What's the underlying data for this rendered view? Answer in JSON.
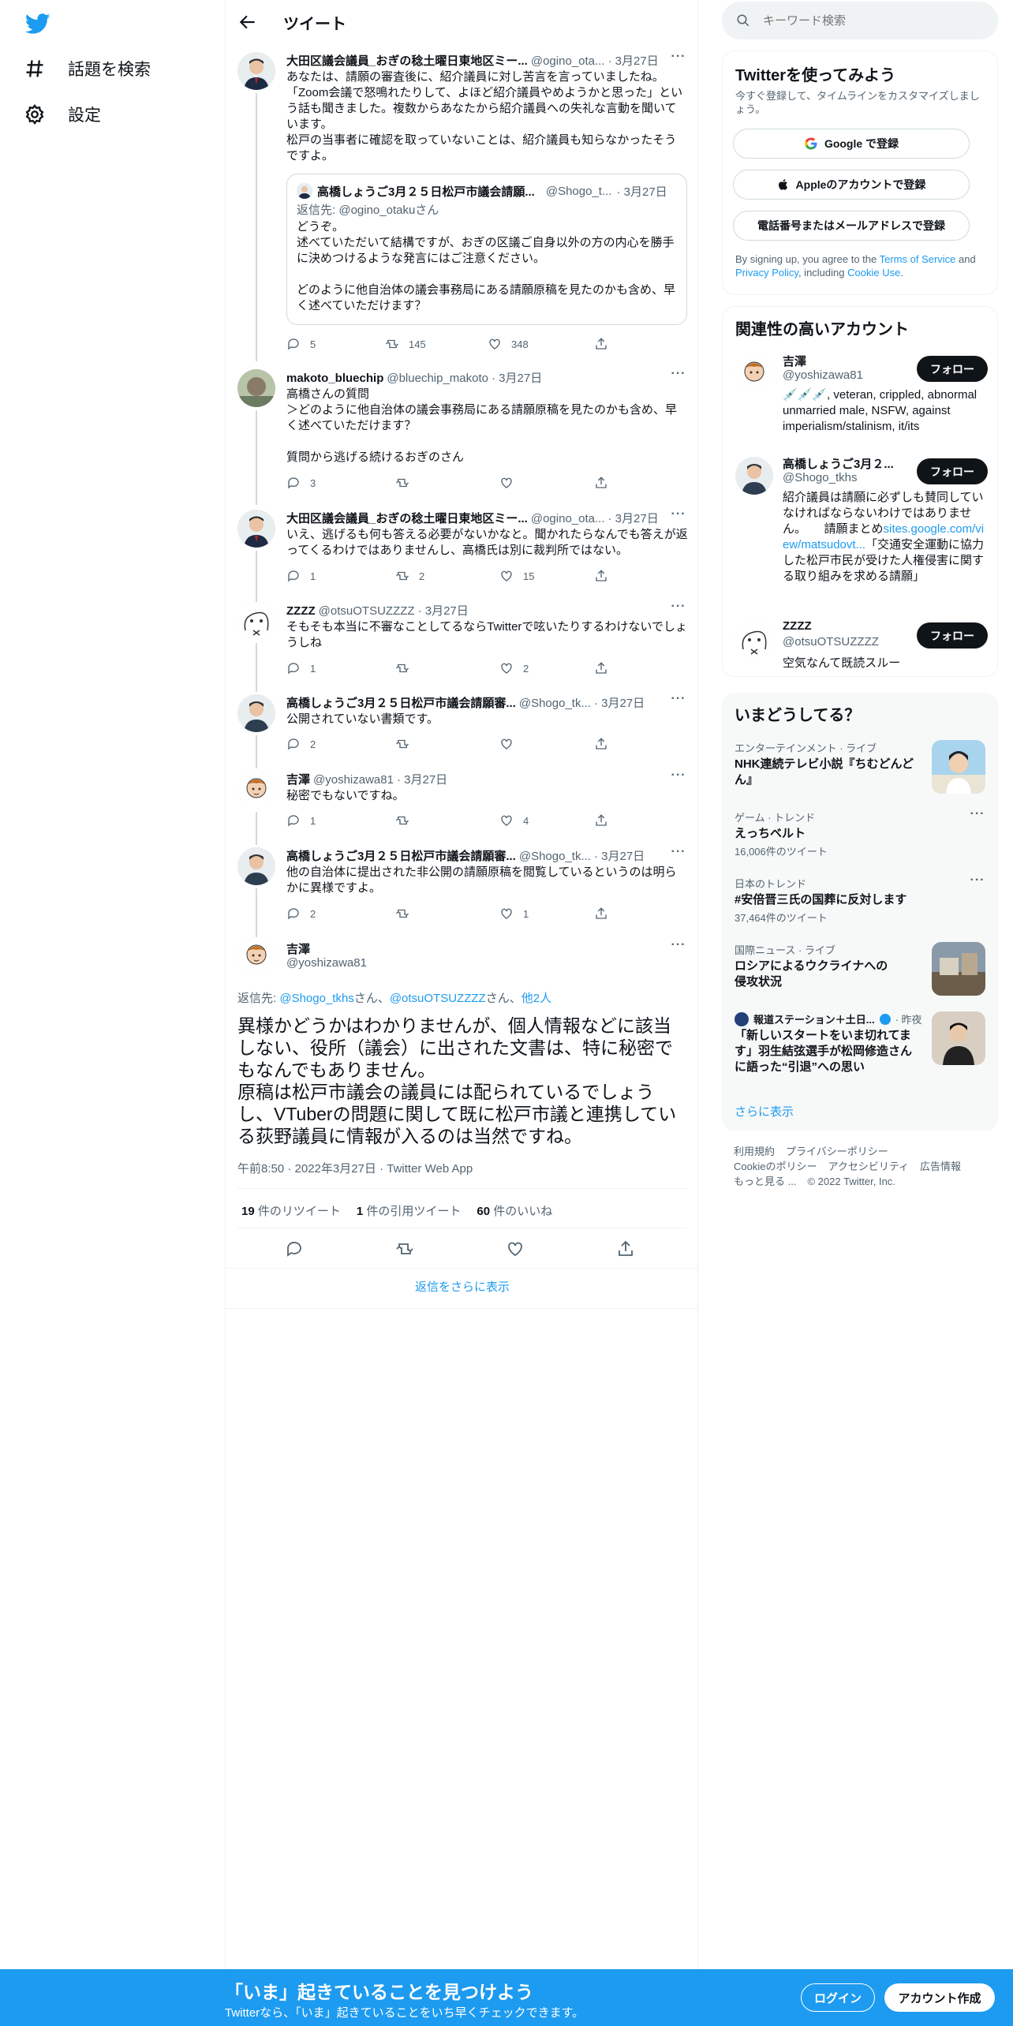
{
  "nav": {
    "explore_label": "話題を検索",
    "settings_label": "設定"
  },
  "header": {
    "title": "ツイート"
  },
  "tweets": [
    {
      "name": "大田区議会議員_おぎの稔土曜日東地区ミー...",
      "handle": "@ogino_ota...",
      "date": "· 3月27日",
      "text": "あなたは、請願の審査後に、紹介議員に対し苦言を言っていましたね。\n「Zoom会議で怒鳴れたりして、よほど紹介議員やめようかと思った」という話も聞きました。複数からあなたから紹介議員への失礼な言動を聞いています。\n松戸の当事者に確認を取っていないことは、紹介議員も知らなかったそうですよ。",
      "replies": "5",
      "retweets": "145",
      "likes": "348",
      "quote": {
        "name": "高橋しょうご3月２５日松戸市議会請願...",
        "handle": "@Shogo_t...",
        "date": "· 3月27日",
        "reply_prefix": "返信先: ",
        "reply_to": "@ogino_otakuさん",
        "text": "どうぞ。\n述べていただいて結構ですが、おぎの区議ご自身以外の方の内心を勝手に決めつけるような発言にはご注意ください。\n\nどのように他自治体の議会事務局にある請願原稿を見たのかも含め、早く述べていただけます？"
      }
    },
    {
      "name": "makoto_bluechip",
      "handle": "@bluechip_makoto",
      "date": "· 3月27日",
      "text": "高橋さんの質問\n＞どのように他自治体の議会事務局にある請願原稿を見たのかも含め、早く述べていただけます？\n\n質問から逃げる続けるおぎのさん",
      "replies": "3",
      "retweets": "",
      "likes": ""
    },
    {
      "name": "大田区議会議員_おぎの稔土曜日東地区ミー...",
      "handle": "@ogino_ota...",
      "date": "· 3月27日",
      "text": "いえ、逃げるも何も答える必要がないかなと。聞かれたらなんでも答えが返ってくるわけではありませんし、高橋氏は別に裁判所ではない。",
      "replies": "1",
      "retweets": "2",
      "likes": "15"
    },
    {
      "name": "ZZZZ",
      "handle": "@otsuOTSUZZZZ",
      "date": "· 3月27日",
      "text": "そもそも本当に不審なことしてるならTwitterで呟いたりするわけないでしょうしね",
      "replies": "1",
      "retweets": "",
      "likes": "2"
    },
    {
      "name": "高橋しょうご3月２５日松戸市議会請願審...",
      "handle": "@Shogo_tk...",
      "date": "· 3月27日",
      "text": "公開されていない書類です。",
      "replies": "2",
      "retweets": "",
      "likes": ""
    },
    {
      "name": "吉澤",
      "handle": "@yoshizawa81",
      "date": "· 3月27日",
      "text": "秘密でもないですね。",
      "replies": "1",
      "retweets": "",
      "likes": "4"
    },
    {
      "name": "高橋しょうご3月２５日松戸市議会請願審...",
      "handle": "@Shogo_tk...",
      "date": "· 3月27日",
      "text": "他の自治体に提出された非公開の請願原稿を閲覧しているというのは明らかに異様ですよ。",
      "replies": "2",
      "retweets": "",
      "likes": "1"
    }
  ],
  "focus": {
    "name": "吉澤",
    "handle": "@yoshizawa81",
    "reply_prefix": "返信先: ",
    "reply_to_1": "@Shogo_tkhs",
    "san_1": "さん、",
    "reply_to_2": "@otsuOTSUZZZZ",
    "san_2": "さん、",
    "others": "他2人",
    "text": "異様かどうかはわかりませんが、個人情報などに該当しない、役所（議会）に出された文書は、特に秘密でもなんでもありません。\n原稿は松戸市議会の議員には配られているでしょうし、VTuberの問題に関して既に松戸市議と連携している荻野議員に情報が入るのは当然ですね。",
    "meta": "午前8:50 · 2022年3月27日 · Twitter Web App",
    "rt_count": "19",
    "rt_label": " 件のリツイート",
    "quote_count": "1",
    "quote_label": " 件の引用ツイート",
    "like_count": "60",
    "like_label": " 件のいいね",
    "show_more": "返信をさらに表示"
  },
  "right": {
    "search_placeholder": "キーワード検索",
    "signup": {
      "title": "Twitterを使ってみよう",
      "subtitle": "今すぐ登録して、タイムラインをカスタマイズしましょう。",
      "google": "Google で登録",
      "apple": "Appleのアカウントで登録",
      "phone": "電話番号またはメールアドレスで登録",
      "terms_1": "By signing up, you agree to the ",
      "terms_link": "Terms of Service",
      "terms_2": " and ",
      "privacy_link": "Privacy Policy",
      "terms_3": ", including ",
      "cookie_link": "Cookie Use",
      "terms_4": "."
    },
    "related": {
      "title": "関連性の高いアカウント",
      "follow_label": "フォロー",
      "accounts": [
        {
          "name": "吉澤",
          "handle": "@yoshizawa81",
          "bio": "💉💉💉, veteran, crippled, abnormal unmarried male, NSFW, against imperialism/stalinism, it/its"
        },
        {
          "name": "高橋しょうご3月２...",
          "handle": "@Shogo_tkhs",
          "bio_1": "紹介議員は請願に必ずしも賛同していなければならないわけではありません。　　請願まとめ",
          "bio_link": "sites.google.com/view/matsudovt...",
          "bio_2": "「交通安全運動に協力した松戸市民が受けた人権侵害に関する取り組みを求める請願」"
        },
        {
          "name": "ZZZZ",
          "handle": "@otsuOTSUZZZZ",
          "bio": "空気なんて既読スルー"
        }
      ]
    },
    "trends": {
      "title": "いまどうしてる？",
      "items": [
        {
          "category": "エンターテインメント · ライブ",
          "title": "NHK連続テレビ小説『ちむどんどん』"
        },
        {
          "category": "ゲーム · トレンド",
          "title": "えっちベルト",
          "count": "16,006件のツイート"
        },
        {
          "category": "日本のトレンド",
          "title": "#安倍晋三氏の国葬に反対します",
          "count": "37,464件のツイート"
        },
        {
          "category": "国際ニュース · ライブ",
          "title": "ロシアによるウクライナへの侵攻状況"
        },
        {
          "source": "報道ステーション＋土日...",
          "when": "· 昨夜",
          "title": "「新しいスタートをいま切れてます」羽生結弦選手が松岡修造さんに語った“引退”への思い"
        }
      ],
      "show_more": "さらに表示"
    },
    "footer": {
      "l1": [
        "利用規約",
        "プライバシーポリシー"
      ],
      "l2": [
        "Cookieのポリシー",
        "アクセシビリティ",
        "広告情報"
      ],
      "l3": [
        "もっと見る ...",
        "© 2022 Twitter, Inc."
      ]
    }
  },
  "banner": {
    "title": "「いま」起きていることを見つけよう",
    "subtitle": "Twitterなら、「いま」起きていることをいち早くチェックできます。",
    "login": "ログイン",
    "signup": "アカウント作成"
  },
  "colors": {
    "accent": "#1d9bf0",
    "text": "#0f1419",
    "secondary": "#536471",
    "follow_bg": "#0f1419"
  }
}
